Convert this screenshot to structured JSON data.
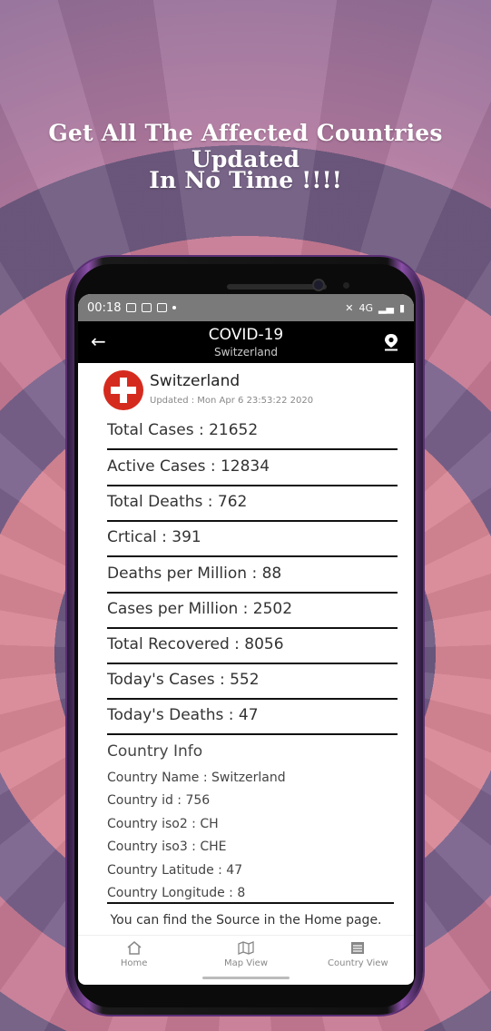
{
  "promo": {
    "line1": "Get All The Affected Countries Updated",
    "line2": "In No Time !!!!"
  },
  "status_bar": {
    "time": "00:18",
    "network": "4G"
  },
  "app_bar": {
    "title": "COVID-19",
    "subtitle": "Switzerland"
  },
  "country_header": {
    "name": "Switzerland",
    "updated": "Updated : Mon Apr  6 23:53:22 2020"
  },
  "stats": [
    "Total Cases : 21652",
    "Active Cases : 12834",
    "Total Deaths : 762",
    "Crtical : 391",
    "Deaths per Million : 88",
    "Cases per Million : 2502",
    "Total Recovered : 8056",
    "Today's Cases : 552",
    "Today's Deaths : 47"
  ],
  "country_info": {
    "title": "Country Info",
    "items": [
      "Country Name : Switzerland",
      "Country id : 756",
      "Country iso2 : CH",
      "Country iso3 : CHE",
      "Country Latitude : 47",
      "Country Longitude : 8"
    ]
  },
  "source_note": "You can find the Source in the Home page.",
  "bottom_nav": [
    {
      "label": "Home",
      "icon": "home-icon"
    },
    {
      "label": "Map View",
      "icon": "map-icon"
    },
    {
      "label": "Country View",
      "icon": "list-icon"
    }
  ],
  "colors": {
    "flag_red": "#d52b1e",
    "app_bar": "#000000",
    "status_bar": "#7a7a7a"
  }
}
